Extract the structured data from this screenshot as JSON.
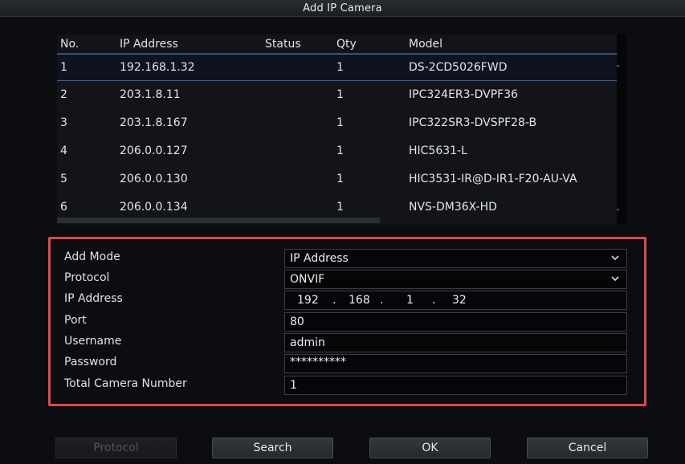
{
  "window": {
    "title": "Add IP Camera"
  },
  "table": {
    "headers": {
      "no": "No.",
      "ip": "IP Address",
      "status": "Status",
      "qty": "Qty",
      "model": "Model"
    },
    "rows": [
      {
        "no": "1",
        "ip": "192.168.1.32",
        "status": "",
        "qty": "1",
        "model": "DS-2CD5026FWD"
      },
      {
        "no": "2",
        "ip": "203.1.8.11",
        "status": "",
        "qty": "1",
        "model": "IPC324ER3-DVPF36"
      },
      {
        "no": "3",
        "ip": "203.1.8.167",
        "status": "",
        "qty": "1",
        "model": "IPC322SR3-DVSPF28-B"
      },
      {
        "no": "4",
        "ip": "206.0.0.127",
        "status": "",
        "qty": "1",
        "model": "HIC5631-L"
      },
      {
        "no": "5",
        "ip": "206.0.0.130",
        "status": "",
        "qty": "1",
        "model": "HIC3531-IR@D-IR1-F20-AU-VA"
      },
      {
        "no": "6",
        "ip": "206.0.0.134",
        "status": "",
        "qty": "1",
        "model": "NVS-DM36X-HD"
      }
    ],
    "selected_row": 1
  },
  "form": {
    "add_mode": {
      "label": "Add Mode",
      "value": "IP Address"
    },
    "protocol": {
      "label": "Protocol",
      "value": "ONVIF"
    },
    "ip_address": {
      "label": "IP Address",
      "octets": [
        "192",
        "168",
        "1",
        "32"
      ],
      "dot": "."
    },
    "port": {
      "label": "Port",
      "value": "80"
    },
    "username": {
      "label": "Username",
      "value": "admin"
    },
    "password": {
      "label": "Password",
      "value": "**********"
    },
    "total_camera_number": {
      "label": "Total Camera Number",
      "value": "1"
    }
  },
  "buttons": {
    "protocol": "Protocol",
    "search": "Search",
    "ok": "OK",
    "cancel": "Cancel"
  },
  "colors": {
    "highlight_border": "#e0484d",
    "selection_line": "#3566a8",
    "background": "#0c0d11"
  }
}
